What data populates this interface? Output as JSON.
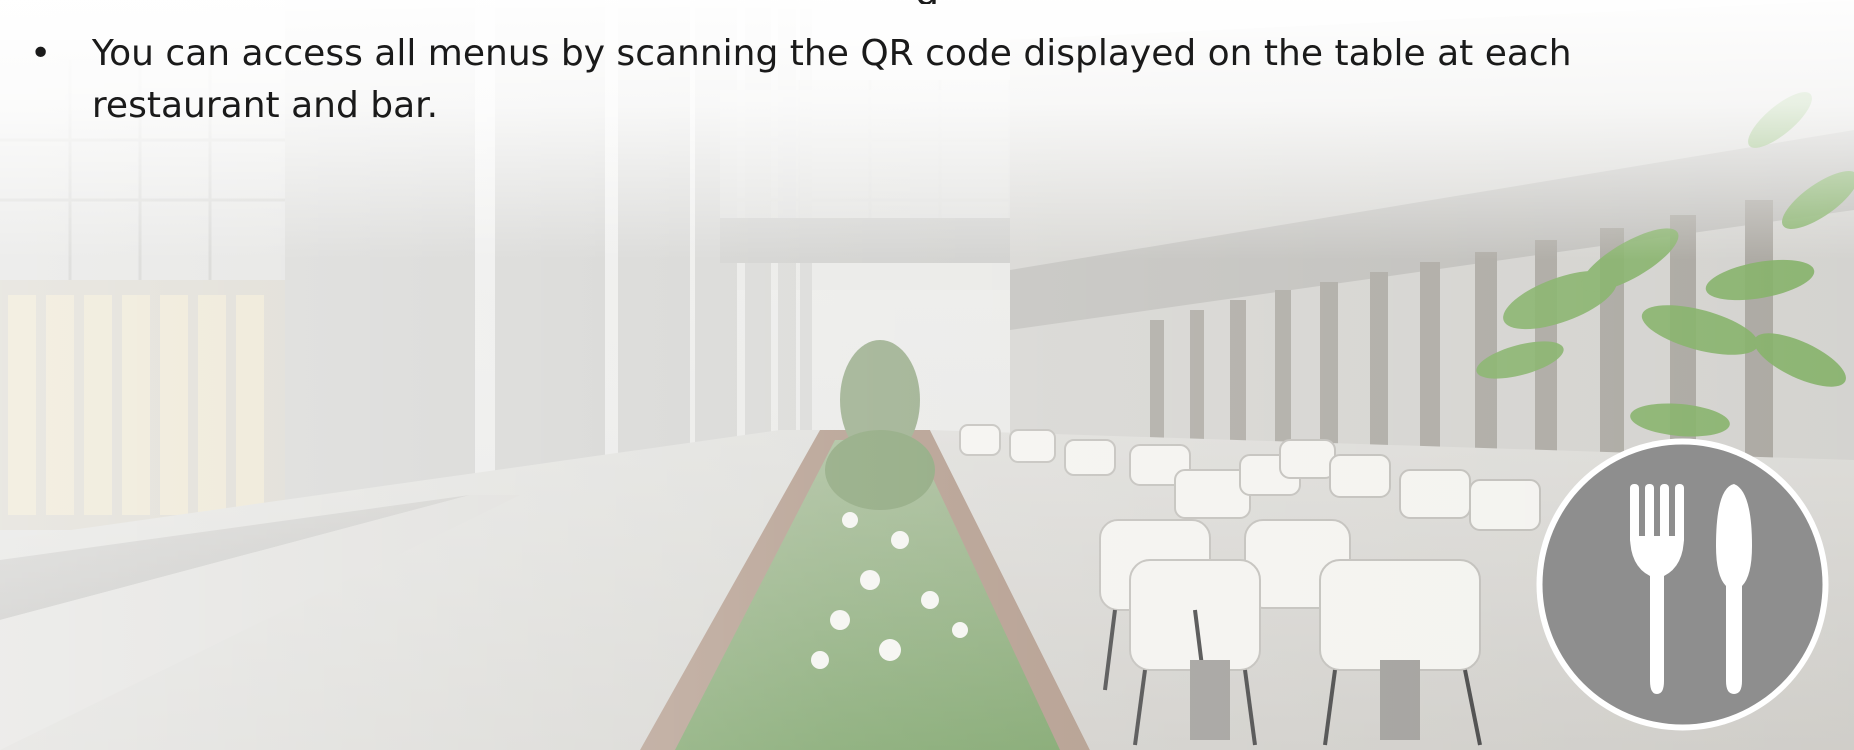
{
  "slide": {
    "top_heading_partial": "g",
    "bullet_symbol": "•",
    "bullet_text": "You can access all menus by scanning the QR code displayed on the table at each restaurant and bar.",
    "icon": "fork-knife-icon",
    "colors": {
      "icon_circle": "#8e8e8e",
      "icon_ring": "#ffffff",
      "text": "#1a1a1a"
    }
  }
}
